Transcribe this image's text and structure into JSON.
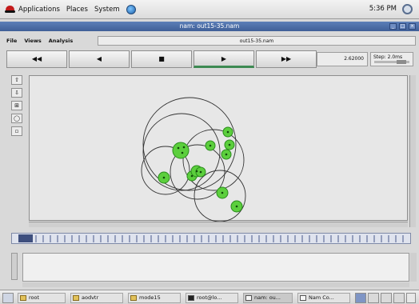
{
  "top_panel": {
    "menus": [
      "Applications",
      "Places",
      "System"
    ],
    "clock": "5:36 PM"
  },
  "window": {
    "title": "nam: out15-35.nam",
    "buttons": [
      "_",
      "□",
      "×"
    ]
  },
  "menubar": {
    "items": [
      "File",
      "Views",
      "Analysis"
    ],
    "filename": "out15-35.nam"
  },
  "controls": {
    "rewind": "◀◀",
    "back": "◀",
    "stop": "■",
    "play": "▶",
    "fast_forward": "▶▶",
    "time": "2.62000",
    "step": "Step: 2.0ms"
  },
  "tools": [
    "⇧",
    "⇩",
    "⊞",
    "◯",
    "▫"
  ],
  "accent": {
    "node_fill": "#5ccf3d",
    "node_stroke": "#2a8c1c",
    "titlebar": "#4a6aa5",
    "active_play": "#3d8a52"
  },
  "taskbar": {
    "items": [
      "root",
      "aodvtr",
      "mode15",
      "root@lo...",
      "nam: ou...",
      "Nam Co..."
    ]
  }
}
